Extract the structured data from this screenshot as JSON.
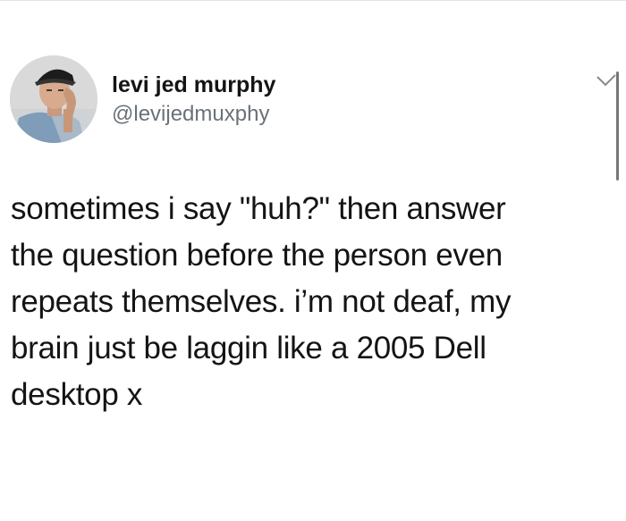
{
  "tweet": {
    "author": {
      "display_name": "levi jed murphy",
      "handle": "@levijedmuxphy",
      "avatar_icon": "profile-photo"
    },
    "text": "sometimes i say \"huh?\" then answer\nthe question before the person even\nrepeats themselves. i’m not deaf, my\nbrain just be laggin like a 2005 Dell\ndesktop x",
    "menu_icon": "chevron-down-icon"
  }
}
